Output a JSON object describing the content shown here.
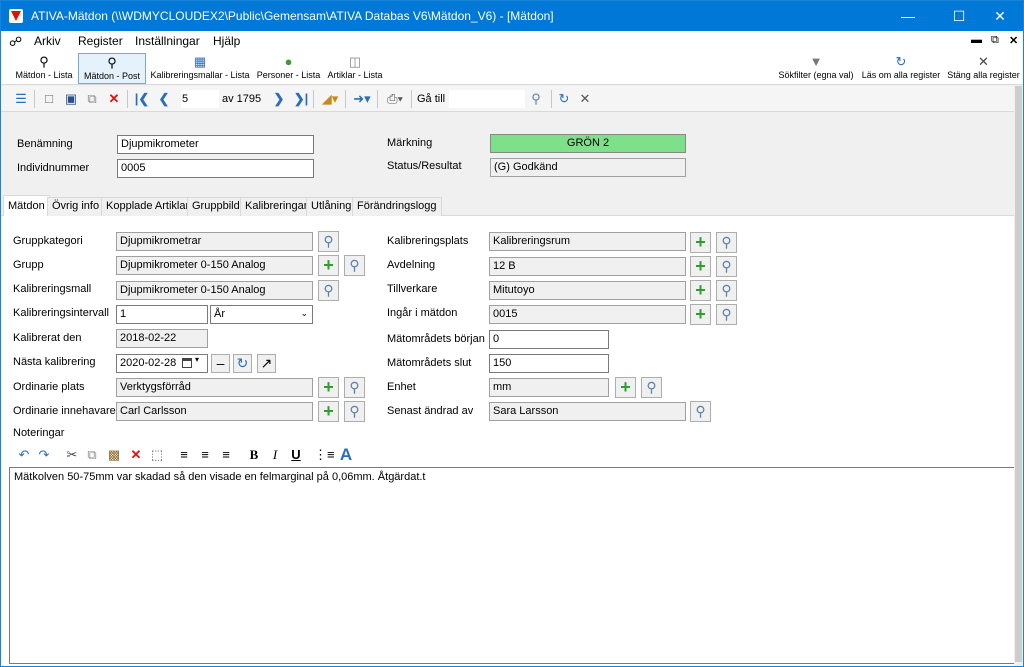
{
  "window": {
    "title": "ATIVA-Mätdon (\\\\WDMYCLOUDEX2\\Public\\Gemensam\\ATIVA Databas V6\\Mätdon_V6) - [Mätdon]"
  },
  "menu": {
    "items": [
      "Arkiv",
      "Register",
      "Inställningar",
      "Hjälp"
    ]
  },
  "ribbon": {
    "left": [
      "Mätdon - Lista",
      "Mätdon - Post",
      "Kalibreringsmallar - Lista",
      "Personer - Lista",
      "Artiklar - Lista"
    ],
    "right": [
      "Sökfilter (egna val)",
      "Läs om alla register",
      "Stäng alla register"
    ]
  },
  "nav": {
    "record": "5",
    "of_label": "av 1795",
    "goto_label": "Gå till",
    "goto_value": ""
  },
  "header": {
    "benamning_label": "Benämning",
    "benamning": "Djupmikrometer",
    "individ_label": "Individnummer",
    "individ": "0005",
    "markning_label": "Märkning",
    "markning": "GRÖN 2",
    "status_label": "Status/Resultat",
    "status": "(G) Godkänd",
    "markning_color": "#7fe08a"
  },
  "tabs": [
    "Mätdon",
    "Övrig info",
    "Kopplade Artiklar",
    "Gruppbild",
    "Kalibreringar",
    "Utlåning",
    "Förändringslogg"
  ],
  "left_fields": {
    "gruppkategori_label": "Gruppkategori",
    "gruppkategori": "Djupmikrometrar",
    "grupp_label": "Grupp",
    "grupp": "Djupmikrometer 0-150 Analog",
    "kalmall_label": "Kalibreringsmall",
    "kalmall": "Djupmikrometer 0-150 Analog",
    "kalint_label": "Kalibreringsintervall",
    "kalint": "1",
    "kalint_unit": "År",
    "kaldatum_label": "Kalibrerat den",
    "kaldatum": "2018-02-22",
    "nasta_label": "Nästa kalibrering",
    "nasta": "2020-02-28",
    "ordplats_label": "Ordinarie plats",
    "ordplats": "Verktygsförråd",
    "ordinnehavare_label": "Ordinarie innehavare",
    "ordinnehavare": "Carl Carlsson",
    "noteringar_label": "Noteringar"
  },
  "right_fields": {
    "kalplats_label": "Kalibreringsplats",
    "kalplats": "Kalibreringsrum",
    "avdelning_label": "Avdelning",
    "avdelning": "12 B",
    "tillverkare_label": "Tillverkare",
    "tillverkare": "Mitutoyo",
    "ingar_label": "Ingår i mätdon",
    "ingar": "0015",
    "borjan_label": "Mätområdets början",
    "borjan": "0",
    "slut_label": "Mätområdets slut",
    "slut": "150",
    "enhet_label": "Enhet",
    "enhet": "mm",
    "andrad_label": "Senast ändrad av",
    "andrad": "Sara Larsson"
  },
  "notes": {
    "text": "Mätkolven 50-75mm var skadad så den visade en felmarginal på 0,06mm. Åtgärdat.t"
  }
}
